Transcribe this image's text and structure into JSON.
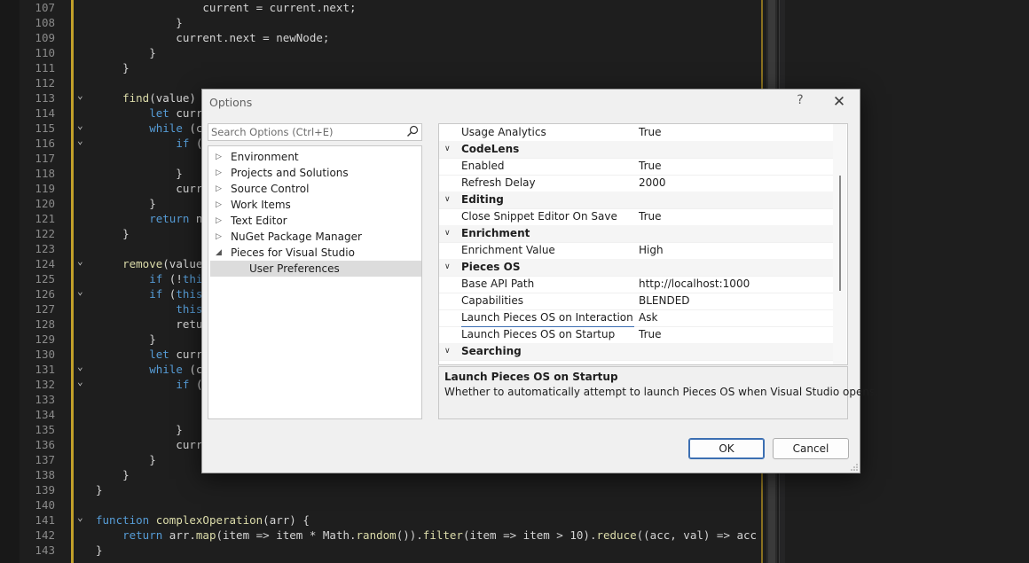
{
  "editor": {
    "lines": [
      {
        "n": "107",
        "fold": "",
        "text": "                current = current.next;"
      },
      {
        "n": "108",
        "fold": "",
        "text": "            }"
      },
      {
        "n": "109",
        "fold": "",
        "text": "            current.next = newNode;"
      },
      {
        "n": "110",
        "fold": "",
        "text": "        }"
      },
      {
        "n": "111",
        "fold": "",
        "text": "    }"
      },
      {
        "n": "112",
        "fold": "",
        "text": ""
      },
      {
        "n": "113",
        "fold": "v",
        "text": "    find(value)"
      },
      {
        "n": "114",
        "fold": "",
        "text": "        let curr"
      },
      {
        "n": "115",
        "fold": "v",
        "text": "        while (c"
      },
      {
        "n": "116",
        "fold": "v",
        "text": "            if ("
      },
      {
        "n": "117",
        "fold": "",
        "text": ""
      },
      {
        "n": "118",
        "fold": "",
        "text": "            }"
      },
      {
        "n": "119",
        "fold": "",
        "text": "            curr"
      },
      {
        "n": "120",
        "fold": "",
        "text": "        }"
      },
      {
        "n": "121",
        "fold": "",
        "text": "        return n"
      },
      {
        "n": "122",
        "fold": "",
        "text": "    }"
      },
      {
        "n": "123",
        "fold": "",
        "text": ""
      },
      {
        "n": "124",
        "fold": "v",
        "text": "    remove(value"
      },
      {
        "n": "125",
        "fold": "",
        "text": "        if (!thi"
      },
      {
        "n": "126",
        "fold": "v",
        "text": "        if (this"
      },
      {
        "n": "127",
        "fold": "",
        "text": "            this"
      },
      {
        "n": "128",
        "fold": "",
        "text": "            retu"
      },
      {
        "n": "129",
        "fold": "",
        "text": "        }"
      },
      {
        "n": "130",
        "fold": "",
        "text": "        let curr"
      },
      {
        "n": "131",
        "fold": "v",
        "text": "        while (c"
      },
      {
        "n": "132",
        "fold": "v",
        "text": "            if ("
      },
      {
        "n": "133",
        "fold": "",
        "text": ""
      },
      {
        "n": "134",
        "fold": "",
        "text": ""
      },
      {
        "n": "135",
        "fold": "",
        "text": "            }"
      },
      {
        "n": "136",
        "fold": "",
        "text": "            curr"
      },
      {
        "n": "137",
        "fold": "",
        "text": "        }"
      },
      {
        "n": "138",
        "fold": "",
        "text": "    }"
      },
      {
        "n": "139",
        "fold": "",
        "text": "}"
      },
      {
        "n": "140",
        "fold": "",
        "text": ""
      },
      {
        "n": "141",
        "fold": "v",
        "text": "function complexOperation(arr) {"
      },
      {
        "n": "142",
        "fold": "",
        "text": "    return arr.map(item => item * Math.random()).filter(item => item > 10).reduce((acc, val) => acc"
      },
      {
        "n": "143",
        "fold": "",
        "text": "}"
      }
    ]
  },
  "dialog": {
    "title": "Options",
    "help_glyph": "?",
    "close_glyph": "✕",
    "search": {
      "placeholder": "Search Options (Ctrl+E)"
    },
    "tree": [
      {
        "label": "Environment",
        "expanded": false
      },
      {
        "label": "Projects and Solutions",
        "expanded": false
      },
      {
        "label": "Source Control",
        "expanded": false
      },
      {
        "label": "Work Items",
        "expanded": false
      },
      {
        "label": "Text Editor",
        "expanded": false
      },
      {
        "label": "NuGet Package Manager",
        "expanded": false
      },
      {
        "label": "Pieces for Visual Studio",
        "expanded": true
      },
      {
        "label": "User Preferences",
        "child": true,
        "selected": true
      }
    ],
    "grid": [
      {
        "type": "prop",
        "name": "Usage Analytics",
        "value": "True"
      },
      {
        "type": "cat",
        "name": "CodeLens"
      },
      {
        "type": "prop",
        "name": "Enabled",
        "value": "True"
      },
      {
        "type": "prop",
        "name": "Refresh Delay",
        "value": "2000"
      },
      {
        "type": "cat",
        "name": "Editing"
      },
      {
        "type": "prop",
        "name": "Close Snippet Editor On Save",
        "value": "True"
      },
      {
        "type": "cat",
        "name": "Enrichment"
      },
      {
        "type": "prop",
        "name": "Enrichment Value",
        "value": "High"
      },
      {
        "type": "cat",
        "name": "Pieces OS"
      },
      {
        "type": "prop",
        "name": "Base API Path",
        "value": "http://localhost:1000"
      },
      {
        "type": "prop",
        "name": "Capabilities",
        "value": "BLENDED"
      },
      {
        "type": "prop",
        "name": "Launch Pieces OS on Interaction",
        "value": "Ask",
        "focus": true
      },
      {
        "type": "prop",
        "name": "Launch Pieces OS on Startup",
        "value": "True"
      },
      {
        "type": "cat",
        "name": "Searching"
      }
    ],
    "description": {
      "title": "Launch Pieces OS on Startup",
      "text": "Whether to automatically attempt to launch Pieces OS when Visual Studio opens."
    },
    "buttons": {
      "ok": "OK",
      "cancel": "Cancel"
    }
  },
  "colors": {
    "accent": "#3c6fb2",
    "editor_bg": "#1e1e1e",
    "fold_marker": "#c2a02a"
  }
}
